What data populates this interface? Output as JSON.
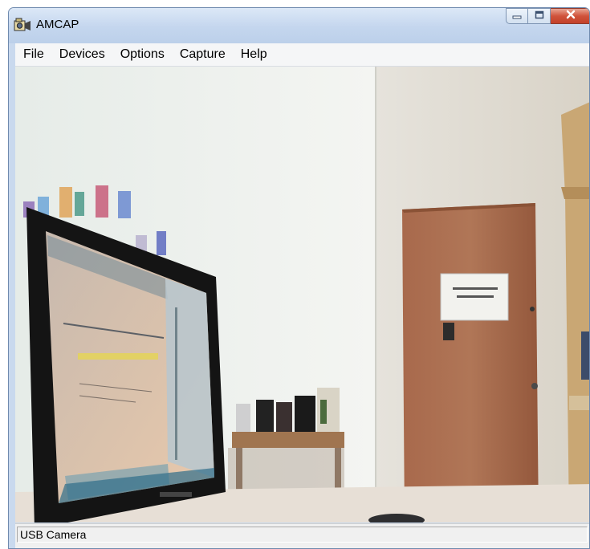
{
  "window": {
    "title": "AMCAP",
    "app_icon": "camera-icon",
    "controls": [
      "minimize-icon",
      "maximize-icon",
      "close-icon"
    ]
  },
  "menu": {
    "items": [
      {
        "label": "File"
      },
      {
        "label": "Devices"
      },
      {
        "label": "Options"
      },
      {
        "label": "Capture"
      },
      {
        "label": "Help"
      }
    ]
  },
  "preview": {
    "content": "live webcam preview"
  },
  "status": {
    "text": "USB Camera"
  },
  "colors": {
    "title_gradient_top": "#dce8f7",
    "close_button": "#d0533b",
    "menubar_bg": "#f5f6f7",
    "wall": "#ecefec",
    "door": "#a0654a"
  }
}
